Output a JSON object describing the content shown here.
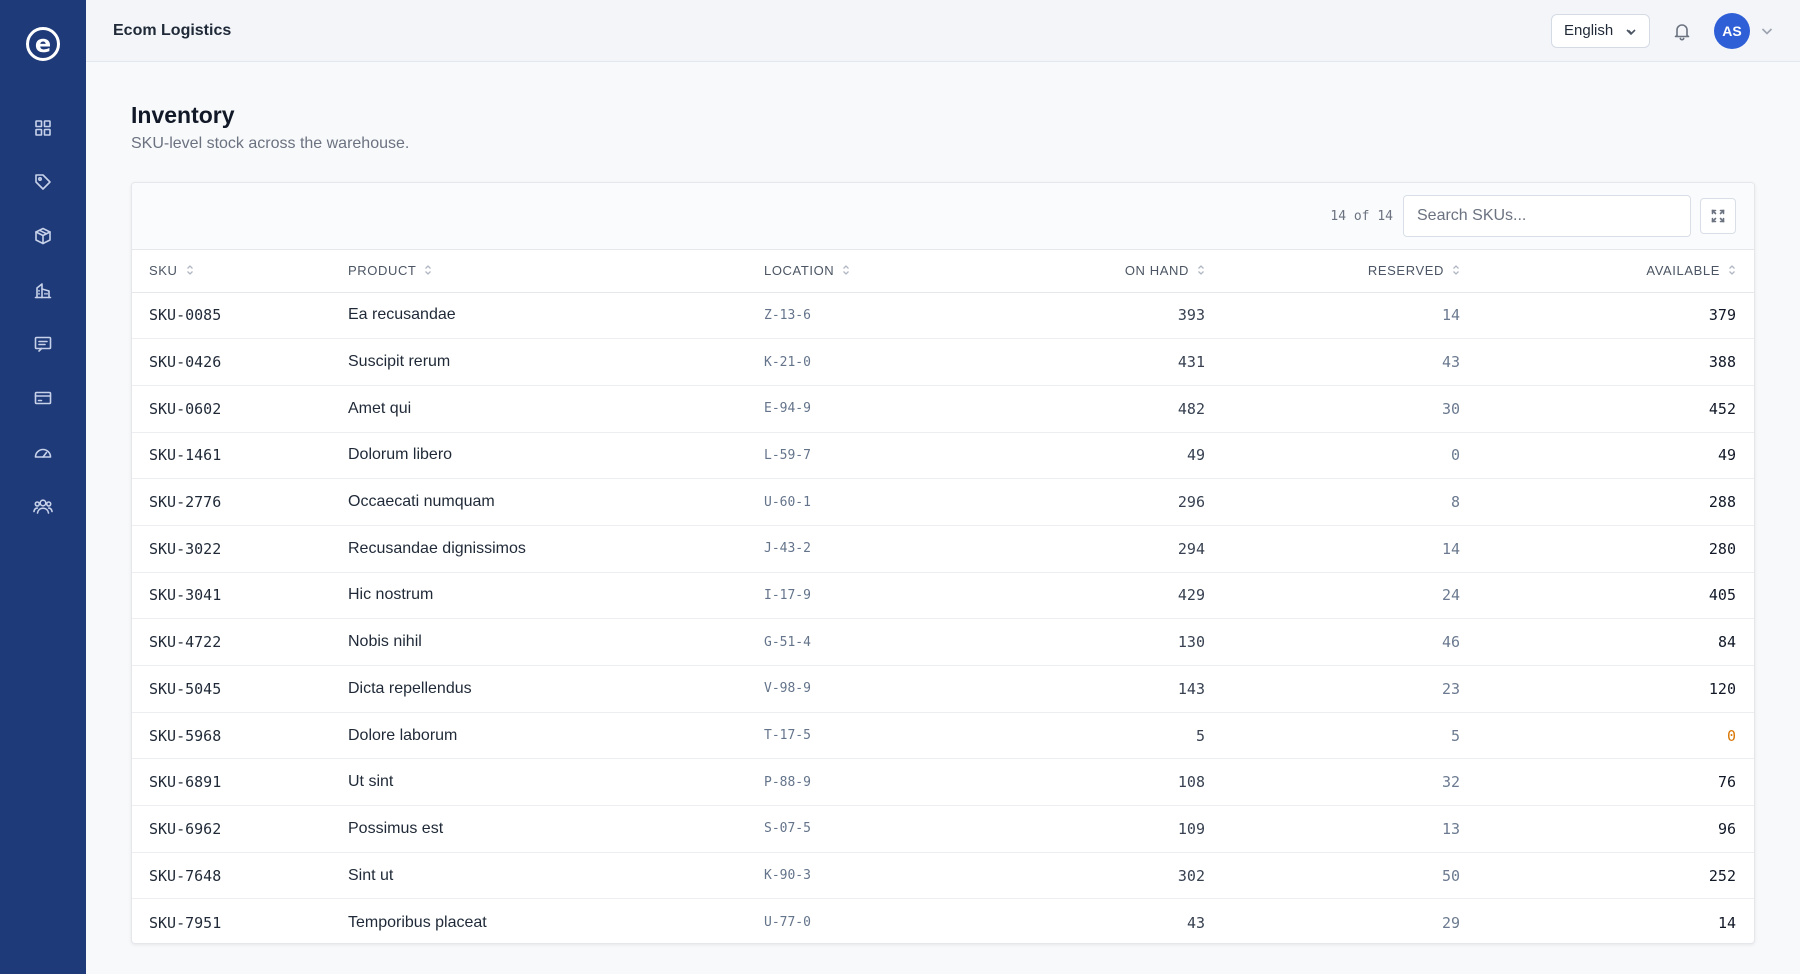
{
  "app": {
    "title": "Ecom Logistics",
    "logo_glyph": "e"
  },
  "sidebar": {
    "items": [
      {
        "name": "dashboard",
        "icon": "grid-icon"
      },
      {
        "name": "products",
        "icon": "tag-icon"
      },
      {
        "name": "inventory",
        "icon": "box-icon"
      },
      {
        "name": "warehouses",
        "icon": "building-icon"
      },
      {
        "name": "messages",
        "icon": "message-icon"
      },
      {
        "name": "billing",
        "icon": "card-icon"
      },
      {
        "name": "performance",
        "icon": "gauge-icon"
      },
      {
        "name": "team",
        "icon": "users-icon"
      }
    ]
  },
  "topbar": {
    "language": "English",
    "avatar_initials": "AS"
  },
  "page": {
    "title": "Inventory",
    "subtitle": "SKU-level stock across the warehouse."
  },
  "table": {
    "count_text": "14 of 14",
    "search_placeholder": "Search SKUs...",
    "columns": [
      "SKU",
      "PRODUCT",
      "LOCATION",
      "ON HAND",
      "RESERVED",
      "AVAILABLE"
    ],
    "rows": [
      {
        "sku": "SKU-0085",
        "product": "Ea recusandae",
        "location": "Z-13-6",
        "on_hand": "393",
        "reserved": "14",
        "available": "379"
      },
      {
        "sku": "SKU-0426",
        "product": "Suscipit rerum",
        "location": "K-21-0",
        "on_hand": "431",
        "reserved": "43",
        "available": "388"
      },
      {
        "sku": "SKU-0602",
        "product": "Amet qui",
        "location": "E-94-9",
        "on_hand": "482",
        "reserved": "30",
        "available": "452"
      },
      {
        "sku": "SKU-1461",
        "product": "Dolorum libero",
        "location": "L-59-7",
        "on_hand": "49",
        "reserved": "0",
        "available": "49"
      },
      {
        "sku": "SKU-2776",
        "product": "Occaecati numquam",
        "location": "U-60-1",
        "on_hand": "296",
        "reserved": "8",
        "available": "288"
      },
      {
        "sku": "SKU-3022",
        "product": "Recusandae dignissimos",
        "location": "J-43-2",
        "on_hand": "294",
        "reserved": "14",
        "available": "280"
      },
      {
        "sku": "SKU-3041",
        "product": "Hic nostrum",
        "location": "I-17-9",
        "on_hand": "429",
        "reserved": "24",
        "available": "405"
      },
      {
        "sku": "SKU-4722",
        "product": "Nobis nihil",
        "location": "G-51-4",
        "on_hand": "130",
        "reserved": "46",
        "available": "84"
      },
      {
        "sku": "SKU-5045",
        "product": "Dicta repellendus",
        "location": "V-98-9",
        "on_hand": "143",
        "reserved": "23",
        "available": "120"
      },
      {
        "sku": "SKU-5968",
        "product": "Dolore laborum",
        "location": "T-17-5",
        "on_hand": "5",
        "reserved": "5",
        "available": "0"
      },
      {
        "sku": "SKU-6891",
        "product": "Ut sint",
        "location": "P-88-9",
        "on_hand": "108",
        "reserved": "32",
        "available": "76"
      },
      {
        "sku": "SKU-6962",
        "product": "Possimus est",
        "location": "S-07-5",
        "on_hand": "109",
        "reserved": "13",
        "available": "96"
      },
      {
        "sku": "SKU-7648",
        "product": "Sint ut",
        "location": "K-90-3",
        "on_hand": "302",
        "reserved": "50",
        "available": "252"
      },
      {
        "sku": "SKU-7951",
        "product": "Temporibus placeat",
        "location": "U-77-0",
        "on_hand": "43",
        "reserved": "29",
        "available": "14"
      }
    ]
  },
  "colors": {
    "sidebar": "#1f3a78",
    "accent": "#2f5fd6",
    "zero_available": "#d97706"
  }
}
